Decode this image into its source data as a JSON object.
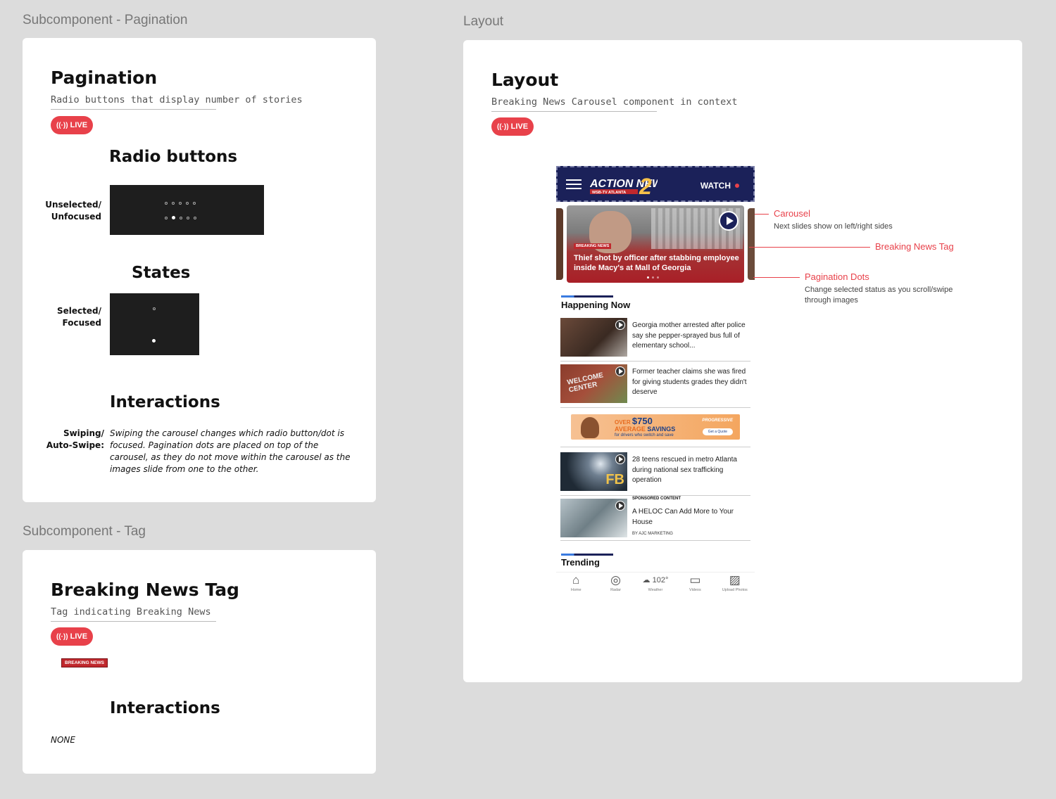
{
  "left_top": {
    "section_label": "Subcomponent - Pagination",
    "title": "Pagination",
    "subtitle": "Radio buttons that display number of stories",
    "live_label": "LIVE",
    "radio_heading": "Radio buttons",
    "unselected_label_1": "Unselected/",
    "unselected_label_2": "Unfocused",
    "states_heading": "States",
    "selected_label_1": "Selected/",
    "selected_label_2": "Focused",
    "interactions_heading": "Interactions",
    "swipe_label_1": "Swiping/",
    "swipe_label_2": "Auto-Swipe:",
    "swipe_text": "Swiping the carousel changes which radio button/dot is focused. Pagination dots are placed on top of the carousel, as they do not move within the carousel as the images slide from one to the other."
  },
  "left_bottom": {
    "section_label": "Subcomponent - Tag",
    "title": "Breaking News Tag",
    "subtitle": "Tag indicating Breaking News",
    "live_label": "LIVE",
    "tag_label": "BREAKING NEWS",
    "interactions_heading": "Interactions",
    "interactions_value": "NONE"
  },
  "right": {
    "section_label": "Layout",
    "title": "Layout",
    "subtitle": "Breaking News Carousel component in context",
    "live_label": "LIVE"
  },
  "phone": {
    "logo_text": "ACTION NEWS",
    "logo_num": "2",
    "logo_sub": "WSB-TV ATLANTA",
    "watch_label": "WATCH",
    "slide_tag": "BREAKING NEWS",
    "slide_headline": "Thief shot by officer after stabbing employee inside Macy's at Mall of Georgia",
    "happening_title": "Happening Now",
    "stories": [
      "Georgia mother arrested after police say she pepper-sprayed bus full of elementary school...",
      "Former teacher claims she was fired for giving students grades they didn't deserve",
      "28 teens rescued in metro Atlanta during national sex trafficking operation",
      "A HELOC Can Add More to Your House"
    ],
    "thumb_text": {
      "welcome": "WELCOME CENTER",
      "fbi": "FB"
    },
    "sponsored_label": "SPONSORED CONTENT",
    "sponsored_by": "BY AJC MARKETING",
    "ad": {
      "line1_pre": "OVER",
      "line1_amount": "$750",
      "line2_a": "AVERAGE",
      "line2_b": "SAVINGS",
      "line3": "for drivers who switch and save",
      "brand": "PROGRESSIVE",
      "cta": "Get a Quote"
    },
    "trending_title": "Trending",
    "tabs": [
      {
        "label": "Home",
        "icon": "home-icon"
      },
      {
        "label": "Radar",
        "icon": "radar-icon"
      },
      {
        "label": "Weather",
        "icon": "weather-icon",
        "temp": "102°"
      },
      {
        "label": "Videos",
        "icon": "video-icon"
      },
      {
        "label": "Upload Photos",
        "icon": "upload-photos-icon"
      }
    ]
  },
  "annotations": {
    "carousel_title": "Carousel",
    "carousel_desc": "Next slides show on left/right sides",
    "tag_title": "Breaking News Tag",
    "dots_title": "Pagination Dots",
    "dots_desc": "Change selected status as you scroll/swipe through images"
  },
  "colors": {
    "accent": "#e8414a",
    "navy": "#1b2159",
    "tag_red": "#c0282d"
  }
}
